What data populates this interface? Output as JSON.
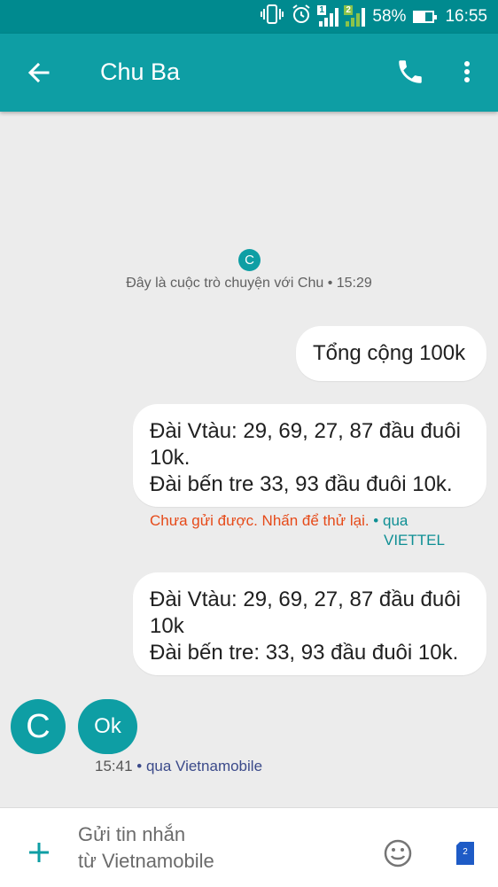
{
  "status_bar": {
    "battery_percent": "58%",
    "battery_level": 0.58,
    "time": "16:55",
    "icons": [
      "vibrate-icon",
      "alarm-icon",
      "sim1-signal-icon",
      "sim2-signal-icon",
      "battery-icon"
    ],
    "sim1_label": "1",
    "sim2_label": "2"
  },
  "app_bar": {
    "title": "Chu Ba",
    "color": "#0e9ea4"
  },
  "conversation": {
    "avatar_letter": "C",
    "info": "Đây là cuộc trò chuyện với Chu • 15:29"
  },
  "messages": {
    "out1": {
      "lines": [
        "Tổng cộng 100k"
      ]
    },
    "out2": {
      "lines": [
        "Đài Vtàu: 29, 69, 27, 87 đầu đuôi",
        "10k.",
        "Đài bến tre 33, 93 đầu đuôi 10k."
      ],
      "status": "Chưa gửi được. Nhấn để thử lại.",
      "separator": "•",
      "via": "qua",
      "carrier": "VIETTEL"
    },
    "out3": {
      "lines": [
        "Đài Vtàu: 29, 69, 27, 87 đầu đuôi",
        "10k",
        "Đài bến tre: 33, 93 đầu đuôi 10k."
      ]
    },
    "in1": {
      "avatar_letter": "C",
      "text": "Ok",
      "time": "15:41",
      "meta": "• qua Vietnamobile"
    }
  },
  "compose": {
    "placeholder_line1": "Gửi tin nhắn",
    "placeholder_line2": "từ Vietnamobile",
    "sim_badge": "2"
  }
}
